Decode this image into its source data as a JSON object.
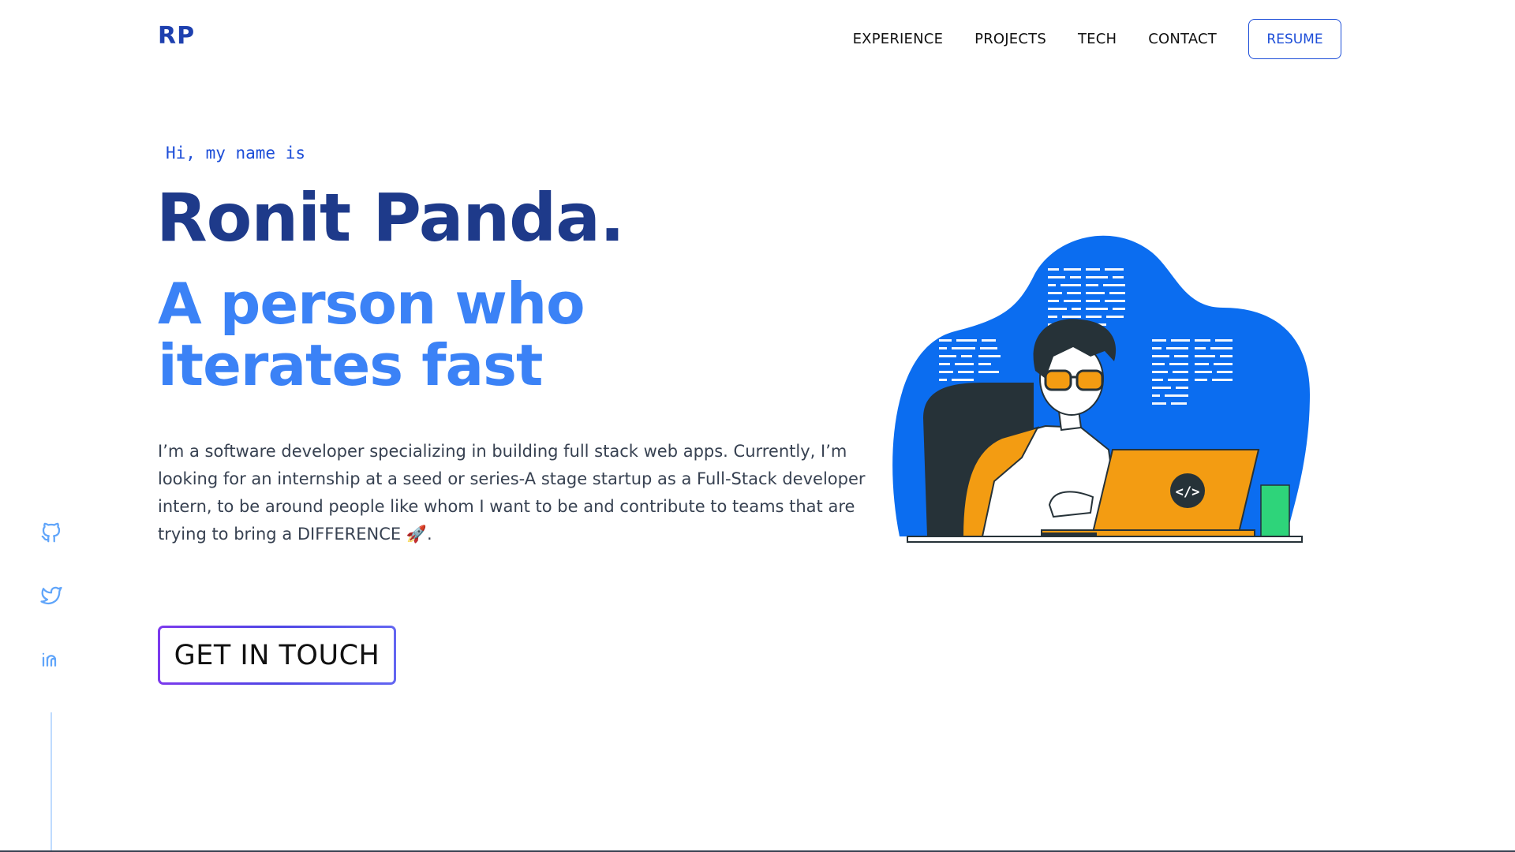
{
  "header": {
    "logo": "RP",
    "nav": [
      {
        "label": "EXPERIENCE"
      },
      {
        "label": "PROJECTS"
      },
      {
        "label": "TECH"
      },
      {
        "label": "CONTACT"
      }
    ],
    "resume_label": "RESUME"
  },
  "hero": {
    "greeting": "Hi, my name is",
    "name": "Ronit Panda.",
    "tagline": "A person who iterates fast",
    "bio": "I’m a software developer specializing in building full stack web apps. Currently, I’m looking for an internship at a seed or series-A stage startup as a Full-Stack developer intern, to be around people like whom I want to be and contribute to teams that are trying to bring a DIFFERENCE 🚀.",
    "cta_label": "GET IN TOUCH",
    "laptop_badge": "</>"
  },
  "social": [
    {
      "icon": "github-icon"
    },
    {
      "icon": "twitter-icon"
    },
    {
      "icon": "linkedin-icon"
    }
  ],
  "colors": {
    "brand": "#1e40af",
    "name": "#1e3a8a",
    "tagline": "#3b82f6",
    "illustration_blob": "#0b6df0",
    "illustration_accent": "#f39c12",
    "cta_gradient_start": "#7c3aed",
    "cta_gradient_end": "#6366f1"
  }
}
